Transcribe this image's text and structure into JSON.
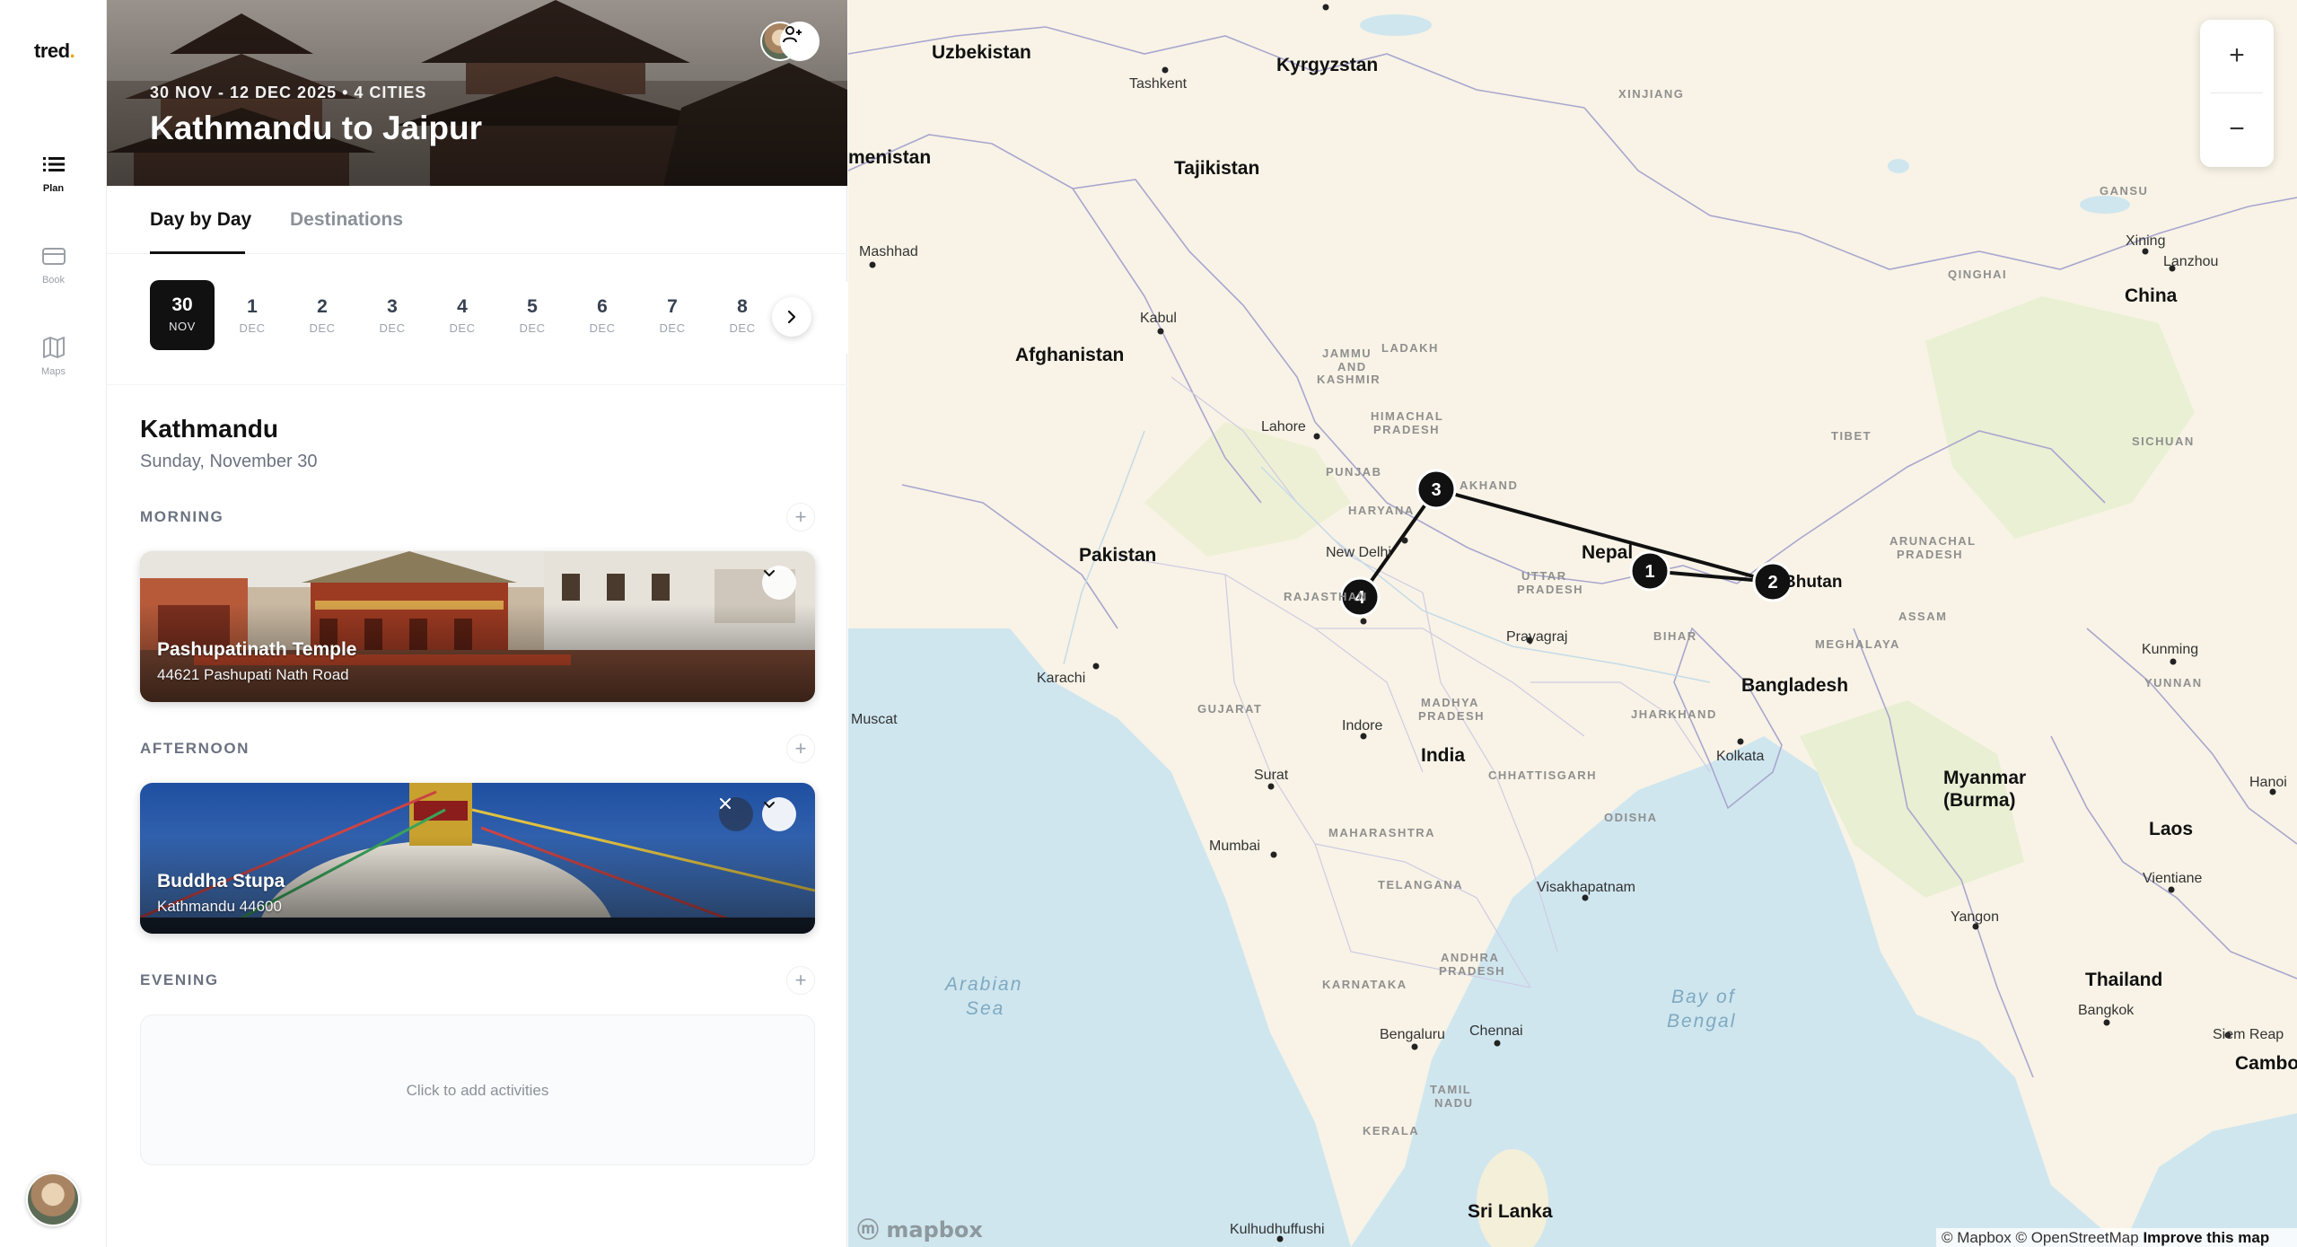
{
  "app": {
    "logo": "tred",
    "logo_dot": "."
  },
  "rail": {
    "items": [
      {
        "label": "Plan",
        "icon": "list-icon"
      },
      {
        "label": "Book",
        "icon": "card-icon"
      },
      {
        "label": "Maps",
        "icon": "map-icon"
      }
    ]
  },
  "trip": {
    "meta": "30 NOV - 12 DEC 2025 • 4 CITIES",
    "title": "Kathmandu to Jaipur"
  },
  "tabs": [
    "Day by Day",
    "Destinations"
  ],
  "days": [
    {
      "num": "30",
      "mon": "NOV"
    },
    {
      "num": "1",
      "mon": "DEC"
    },
    {
      "num": "2",
      "mon": "DEC"
    },
    {
      "num": "3",
      "mon": "DEC"
    },
    {
      "num": "4",
      "mon": "DEC"
    },
    {
      "num": "5",
      "mon": "DEC"
    },
    {
      "num": "6",
      "mon": "DEC"
    },
    {
      "num": "7",
      "mon": "DEC"
    },
    {
      "num": "8",
      "mon": "DEC"
    }
  ],
  "day_detail": {
    "city": "Kathmandu",
    "date": "Sunday, November 30",
    "morning_label": "MORNING",
    "afternoon_label": "AFTERNOON",
    "evening_label": "EVENING",
    "add_glyph": "+",
    "activities": [
      {
        "title": "Pashupatinath Temple",
        "address": "44621 Pashupati Nath Road"
      },
      {
        "title": "Buddha Stupa",
        "address": "Kathmandu 44600"
      }
    ],
    "empty_text": "Click to add activities"
  },
  "map": {
    "zoom_in": "+",
    "zoom_out": "−",
    "mapbox": "mapbox",
    "attribution": "© Mapbox © OpenStreetMap",
    "improve": "Improve this map",
    "labels": {
      "countries": [
        "Uzbekistan",
        "Kyrgyzstan",
        "menistan",
        "Tajikistan",
        "Afghanistan",
        "Pakistan",
        "Nepal",
        "Bhutan",
        "Bangladesh",
        "India",
        "China",
        "Myanmar",
        "(Burma)",
        "Laos",
        "Thailand",
        "Cambodia",
        "Sri Lanka"
      ],
      "cities": [
        "Tashkent",
        "Kabul",
        "Mashhad",
        "Lahore",
        "New Delhi",
        "Karachi",
        "Muscat",
        "Indore",
        "Surat",
        "Mumbai",
        "Prayagraj",
        "Kolkata",
        "Visakhapatnam",
        "Bengaluru",
        "Chennai",
        "Kulhudhuffushi",
        "Xining",
        "Lanzhou",
        "Kunming",
        "Hanoi",
        "Vientiane",
        "Yangon",
        "Bangkok",
        "Siem Reap"
      ],
      "regions": [
        "XINJIANG",
        "QINGHAI",
        "GANSU",
        "TIBET",
        "SICHUAN",
        "YUNNAN",
        "JAMMU",
        "AND",
        "KASHMIR",
        "LADAKH",
        "HIMACHAL",
        "PRADESH",
        "PUNJAB",
        "HARYANA",
        "UTTAR",
        "PRADESH",
        "RAJASTHAN",
        "BIHAR",
        "GUJARAT",
        "MADHYA",
        "PRADESH",
        "JHARKHAND",
        "CHHATTISGARH",
        "ODISHA",
        "MAHARASHTRA",
        "TELANGANA",
        "ANDHRA",
        "PRADESH",
        "KARNATAKA",
        "TAMIL",
        "NADU",
        "KERALA",
        "MEGHALAYA",
        "ASSAM",
        "ARUNACHAL",
        "PRADESH",
        "AKHAND"
      ],
      "seas": [
        "Arabian",
        "Sea",
        "Bay of",
        "Bengal"
      ]
    },
    "route_stops": [
      "1",
      "2",
      "3",
      "4"
    ]
  }
}
